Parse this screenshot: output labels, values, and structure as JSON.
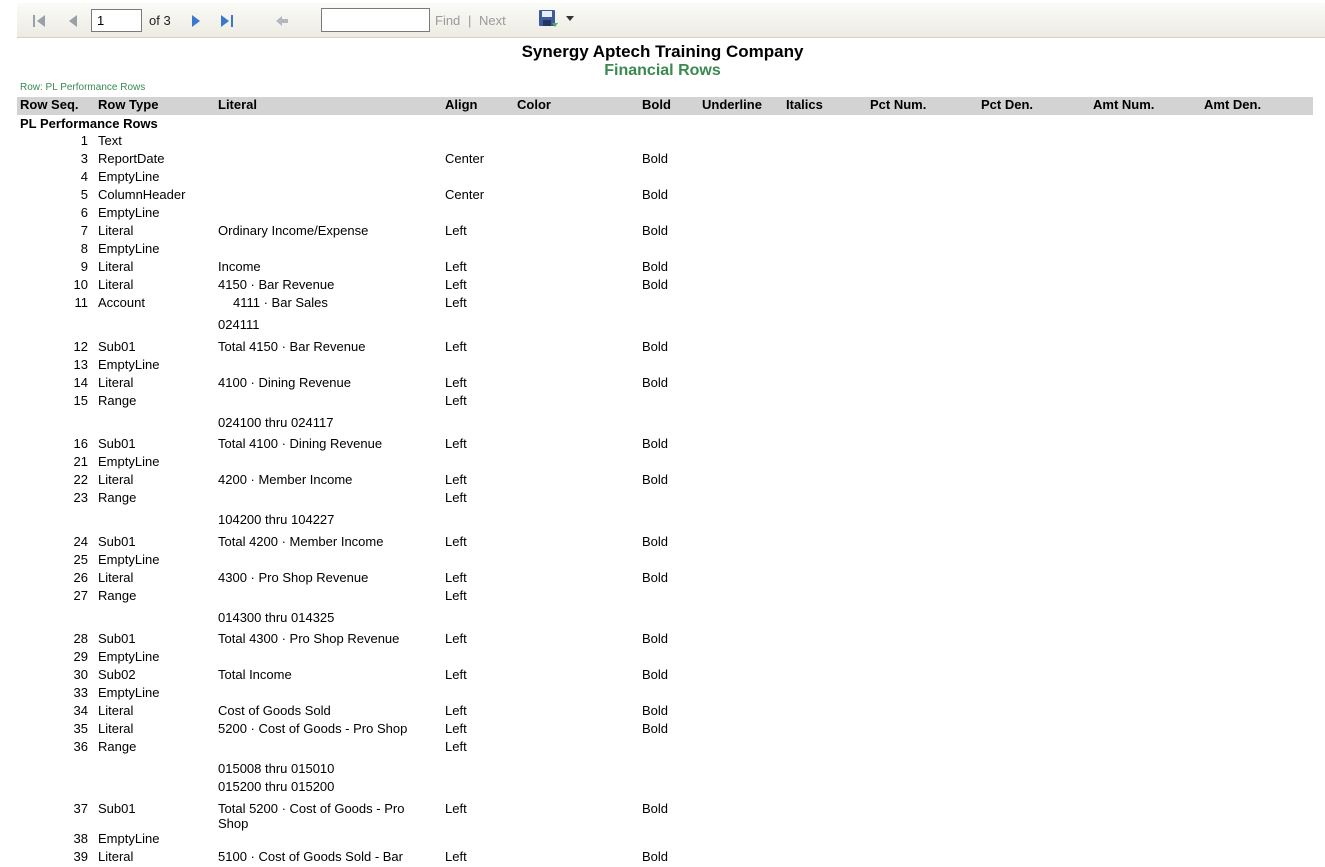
{
  "toolbar": {
    "current_page": "1",
    "of_pages": "of 3",
    "find_value": "",
    "find_label": "Find",
    "separator": "|",
    "next_label": "Next"
  },
  "report": {
    "title": "Synergy Aptech Training Company",
    "subtitle": "Financial Rows",
    "row_crumb": "Row: PL Performance Rows",
    "group_title": "PL Performance Rows"
  },
  "columns": [
    "Row Seq.",
    "Row Type",
    "Literal",
    "Align",
    "Color",
    "Bold",
    "Underline",
    "Italics",
    "Pct Num.",
    "Pct Den.",
    "Amt Num.",
    "Amt Den."
  ],
  "rows": [
    {
      "seq": "1",
      "type": "Text",
      "literal": "",
      "align": "",
      "bold": ""
    },
    {
      "seq": "3",
      "type": "ReportDate",
      "literal": "",
      "align": "Center",
      "bold": "Bold"
    },
    {
      "seq": "4",
      "type": "EmptyLine",
      "literal": "",
      "align": "",
      "bold": ""
    },
    {
      "seq": "5",
      "type": "ColumnHeader",
      "literal": "",
      "align": "Center",
      "bold": "Bold"
    },
    {
      "seq": "6",
      "type": "EmptyLine",
      "literal": "",
      "align": "",
      "bold": ""
    },
    {
      "seq": "7",
      "type": "Literal",
      "literal": "Ordinary Income/Expense",
      "align": "Left",
      "bold": "Bold"
    },
    {
      "seq": "8",
      "type": "EmptyLine",
      "literal": "",
      "align": "",
      "bold": ""
    },
    {
      "seq": "9",
      "type": "Literal",
      "literal": "Income",
      "align": "Left",
      "bold": "Bold"
    },
    {
      "seq": "10",
      "type": "Literal",
      "literal": "4150 · Bar Revenue",
      "align": "Left",
      "bold": "Bold"
    },
    {
      "seq": "11",
      "type": "Account",
      "literal": "4111 · Bar Sales",
      "align": "Left",
      "bold": ""
    },
    {
      "seq": "",
      "type": "",
      "literal": "024111",
      "align": "",
      "bold": ""
    },
    {
      "seq": "12",
      "type": "Sub01",
      "literal": "Total 4150 · Bar Revenue",
      "align": "Left",
      "bold": "Bold"
    },
    {
      "seq": "13",
      "type": "EmptyLine",
      "literal": "",
      "align": "",
      "bold": ""
    },
    {
      "seq": "14",
      "type": "Literal",
      "literal": "4100 · Dining Revenue",
      "align": "Left",
      "bold": "Bold"
    },
    {
      "seq": "15",
      "type": "Range",
      "literal": "",
      "align": "Left",
      "bold": ""
    },
    {
      "seq": "",
      "type": "",
      "literal": "024100 thru 024117",
      "align": "",
      "bold": ""
    },
    {
      "seq": "16",
      "type": "Sub01",
      "literal": "Total 4100 · Dining Revenue",
      "align": "Left",
      "bold": "Bold"
    },
    {
      "seq": "21",
      "type": "EmptyLine",
      "literal": "",
      "align": "",
      "bold": ""
    },
    {
      "seq": "22",
      "type": "Literal",
      "literal": "4200 · Member Income",
      "align": "Left",
      "bold": "Bold"
    },
    {
      "seq": "23",
      "type": "Range",
      "literal": "",
      "align": "Left",
      "bold": ""
    },
    {
      "seq": "",
      "type": "",
      "literal": "104200 thru 104227",
      "align": "",
      "bold": ""
    },
    {
      "seq": "24",
      "type": "Sub01",
      "literal": "Total 4200 · Member Income",
      "align": "Left",
      "bold": "Bold"
    },
    {
      "seq": "25",
      "type": "EmptyLine",
      "literal": "",
      "align": "",
      "bold": ""
    },
    {
      "seq": "26",
      "type": "Literal",
      "literal": "4300 · Pro Shop Revenue",
      "align": "Left",
      "bold": "Bold"
    },
    {
      "seq": "27",
      "type": "Range",
      "literal": "",
      "align": "Left",
      "bold": ""
    },
    {
      "seq": "",
      "type": "",
      "literal": "014300 thru 014325",
      "align": "",
      "bold": ""
    },
    {
      "seq": "28",
      "type": "Sub01",
      "literal": "Total 4300 · Pro Shop Revenue",
      "align": "Left",
      "bold": "Bold"
    },
    {
      "seq": "29",
      "type": "EmptyLine",
      "literal": "",
      "align": "",
      "bold": ""
    },
    {
      "seq": "30",
      "type": "Sub02",
      "literal": "Total Income",
      "align": "Left",
      "bold": "Bold"
    },
    {
      "seq": "33",
      "type": "EmptyLine",
      "literal": "",
      "align": "",
      "bold": ""
    },
    {
      "seq": "34",
      "type": "Literal",
      "literal": "Cost of Goods Sold",
      "align": "Left",
      "bold": "Bold"
    },
    {
      "seq": "35",
      "type": "Literal",
      "literal": "5200 · Cost of Goods - Pro Shop",
      "align": "Left",
      "bold": "Bold"
    },
    {
      "seq": "36",
      "type": "Range",
      "literal": "",
      "align": "Left",
      "bold": ""
    },
    {
      "seq": "",
      "type": "",
      "literal": "015008 thru 015010",
      "align": "",
      "bold": ""
    },
    {
      "seq": "",
      "type": "",
      "literal": "015200 thru 015200",
      "align": "",
      "bold": ""
    },
    {
      "seq": "37",
      "type": "Sub01",
      "literal": "Total 5200 · Cost of Goods - Pro Shop",
      "align": "Left",
      "bold": "Bold"
    },
    {
      "seq": "38",
      "type": "EmptyLine",
      "literal": "",
      "align": "",
      "bold": ""
    },
    {
      "seq": "39",
      "type": "Literal",
      "literal": "5100 · Cost of Goods Sold - Bar",
      "align": "Left",
      "bold": "Bold"
    }
  ]
}
